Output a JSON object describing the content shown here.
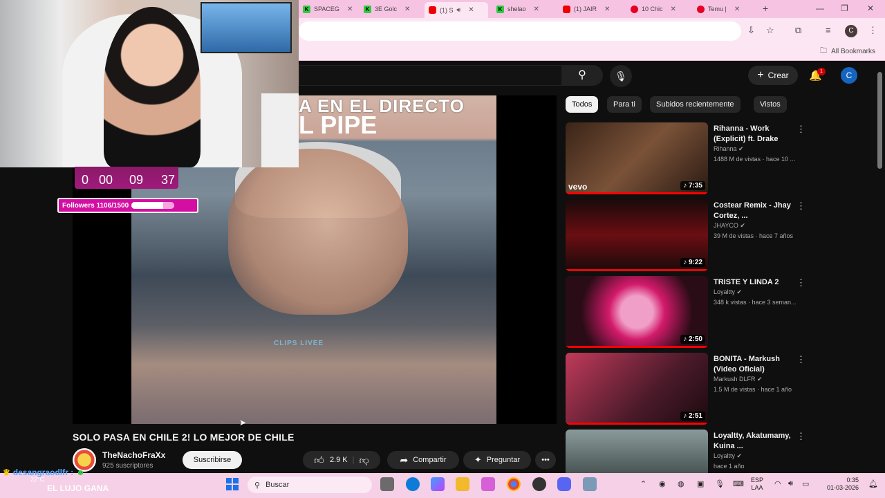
{
  "browser": {
    "tabs": [
      {
        "label": "SPACEG",
        "icon": "k"
      },
      {
        "label": "3E Golc",
        "icon": "k"
      },
      {
        "label": "(1) S",
        "icon": "yt",
        "active": true
      },
      {
        "label": "shelao",
        "icon": "k"
      },
      {
        "label": "(1) JAIR",
        "icon": "yt"
      },
      {
        "label": "10 Chic",
        "icon": "pin"
      },
      {
        "label": "Temu |",
        "icon": "pin"
      }
    ],
    "new_tab": "+",
    "profile_letter": "C",
    "all_bookmarks": "All Bookmarks"
  },
  "youtube": {
    "create_label": "Crear",
    "notifications_count": "1",
    "avatar_letter": "C",
    "chips": [
      "Todos",
      "Para ti",
      "Subidos recientemente",
      "Vistos"
    ],
    "video": {
      "overlay_text_line1": "A EN EL DIRECTO",
      "overlay_text_line2": "L PIPE",
      "watermark": "CLIPS LIVEE",
      "title": "SOLO PASA EN CHILE 2! LO MEJOR DE CHILE",
      "channel": "TheNachoFraXx",
      "subscribers": "925 suscriptores",
      "subscribe_label": "Suscribirse",
      "likes": "2.9 K",
      "share_label": "Compartir",
      "ask_label": "Preguntar"
    },
    "recommendations": [
      {
        "title": "Rihanna - Work (Explicit) ft. Drake",
        "channel": "Rihanna",
        "meta": "1488 M de vistas · hace 10 ...",
        "duration": "7:35",
        "badge": "vevo"
      },
      {
        "title": "Costear Remix - Jhay Cortez, ...",
        "channel": "JHAYCO",
        "meta": "39 M de vistas · hace 7 años",
        "duration": "9:22"
      },
      {
        "title": "TRISTE Y LINDA 2",
        "channel": "Loyaltty",
        "meta": "348 k vistas · hace 3 seman...",
        "duration": "2:50"
      },
      {
        "title": "BONITA - Markush (Video Oficial)",
        "channel": "Markush DLFR",
        "meta": "1.5 M de vistas · hace 1 año",
        "duration": "2:51"
      },
      {
        "title": "Loyaltty, Akatumamy, Kuina ...",
        "channel": "Loyaltty",
        "meta": "hace 1 año",
        "duration": ""
      }
    ]
  },
  "stream_overlay": {
    "timer": [
      "0",
      "00",
      "09",
      "37"
    ],
    "followers_label": "Followers 1106/1500",
    "followers_progress": 0.737,
    "chat_user": "desangraodlfr :",
    "weather": "22°C",
    "chat_message": "EL LUJO GANA"
  },
  "taskbar": {
    "search_placeholder": "Buscar",
    "lang_line1": "ESP",
    "lang_line2": "LAA",
    "time": "0:35",
    "date": "01-03-2026"
  },
  "colors": {
    "tab_bar": "#f7c3e3",
    "toolbar": "#fde6f3",
    "youtube_bg": "#0f0f0f",
    "overlay_pink": "#d40ea3",
    "progress_red": "#ff0000"
  }
}
